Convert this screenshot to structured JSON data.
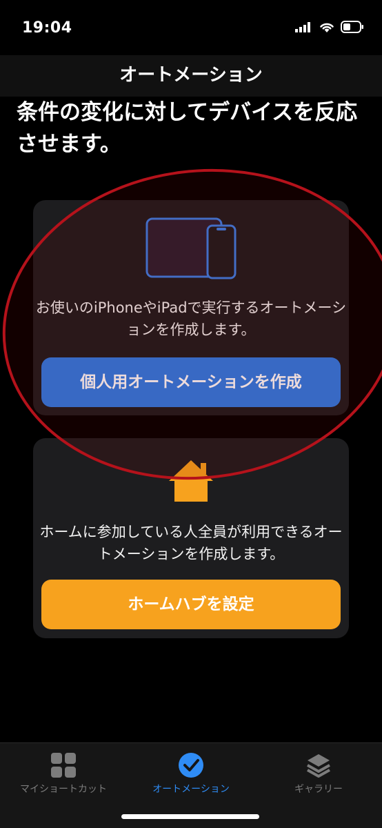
{
  "status_bar": {
    "time": "19:04"
  },
  "nav": {
    "title": "オートメーション"
  },
  "header": {
    "text": "条件の変化に対してデバイスを反応させます。"
  },
  "personal_card": {
    "icon": "iphone-ipad-icon",
    "description": "お使いのiPhoneやiPadで実行するオートメーションを作成します。",
    "button_label": "個人用オートメーションを作成"
  },
  "home_card": {
    "icon": "home-icon",
    "description": "ホームに参加している人全員が利用できるオートメーションを作成します。",
    "button_label": "ホームハブを設定"
  },
  "tabs": [
    {
      "label": "マイショートカット",
      "icon": "grid-icon",
      "selected": false
    },
    {
      "label": "オートメーション",
      "icon": "clock-check-icon",
      "selected": true
    },
    {
      "label": "ギャラリー",
      "icon": "layers-icon",
      "selected": false
    }
  ],
  "colors": {
    "accent_blue": "#2d7be5",
    "accent_orange": "#f7a21e",
    "annotation_red": "#b5121b"
  }
}
